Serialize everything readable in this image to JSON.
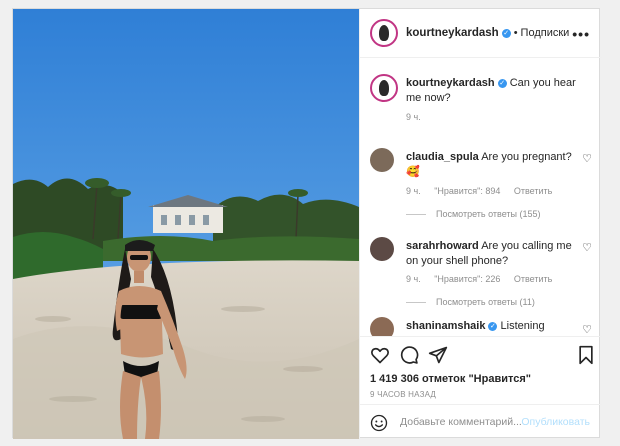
{
  "post": {
    "author": "kourtneykardash",
    "verified_icon": "verified-badge-icon",
    "separator": "•",
    "follow_label": "Подписки",
    "more_icon": "more-options-icon",
    "caption": {
      "username": "kourtneykardash",
      "text": "Can you hear me now?",
      "time": "9 ч."
    },
    "image_icon": "beach-photo"
  },
  "comments": [
    {
      "username": "claudia_spula",
      "text": "Are you pregnant? 🥰",
      "time": "9 ч.",
      "likes": "\"Нравится\": 894",
      "reply": "Ответить",
      "view_replies": "Посмотреть ответы (155)"
    },
    {
      "username": "sarahrhoward",
      "text": "Are you calling me on your shell phone?",
      "time": "9 ч.",
      "likes": "\"Нравится\": 226",
      "reply": "Ответить",
      "view_replies": "Посмотреть ответы (11)"
    },
    {
      "username": "shaninamshaik",
      "text": "Listening"
    }
  ],
  "actions": {
    "icons": [
      "heart-icon",
      "comment-icon",
      "share-icon",
      "bookmark-icon"
    ],
    "likes_text": "1 419 306 отметок \"Нравится\"",
    "time_ago": "9 ЧАСОВ НАЗАД"
  },
  "compose": {
    "placeholder": "Добавьте комментарий...",
    "publish_label": "Опубликовать"
  },
  "colors": {
    "accent": "#3897f0",
    "publish_disabled": "#b2dffc",
    "muted": "#8e8e8e"
  }
}
